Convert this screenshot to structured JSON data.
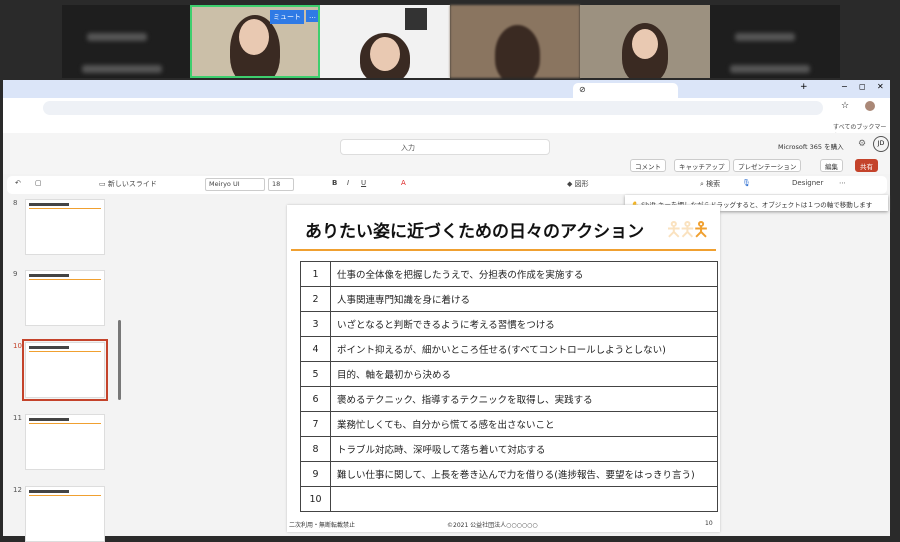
{
  "meeting": {
    "tiles": [
      {
        "state": "video-off"
      },
      {
        "state": "active-speaker",
        "overlay_buttons": [
          "ミュート",
          "…"
        ]
      },
      {
        "state": "video"
      },
      {
        "state": "video"
      },
      {
        "state": "video"
      },
      {
        "state": "video-off"
      }
    ]
  },
  "browser": {
    "window_controls": [
      "−",
      "◻",
      "✕"
    ],
    "new_tab": "+",
    "bookmarks_all": "すべてのブックマーク"
  },
  "app": {
    "search_placeholder": "入力",
    "buy_365": "Microsoft 365 を購入",
    "avatar": "JD",
    "ribbon_buttons": {
      "comment": "コメント",
      "catchup": "キャッチアップ",
      "present": "プレゼンテーション",
      "edit": "編集",
      "share": "共有"
    },
    "toolbar": {
      "new_slide": "新しいスライド",
      "font": "Meiryo UI",
      "size": "18",
      "shapes": "図形",
      "search": "検索",
      "designer": "Designer",
      "more": "⋯"
    },
    "tooltip": "Shift キーを押しながらドラッグすると、オブジェクトは１つの軸で移動します"
  },
  "thumbnails": [
    {
      "num": "8"
    },
    {
      "num": "9"
    },
    {
      "num": "10",
      "selected": true
    },
    {
      "num": "11"
    },
    {
      "num": "12"
    }
  ],
  "slide": {
    "title": "ありたい姿に近づくための日々のアクション",
    "rows": [
      {
        "n": "1",
        "text": "仕事の全体像を把握したうえで、分担表の作成を実施する"
      },
      {
        "n": "2",
        "text": "人事関連専門知識を身に着ける"
      },
      {
        "n": "3",
        "text": "いざとなると判断できるように考える習慣をつける"
      },
      {
        "n": "4",
        "text": "ポイント抑えるが、細かいところ任せる(すべてコントロールしようとしない)"
      },
      {
        "n": "5",
        "text": "目的、軸を最初から決める"
      },
      {
        "n": "6",
        "text": "褒めるテクニック、指導するテクニックを取得し、実践する"
      },
      {
        "n": "7",
        "text": "業務忙しくても、自分から慌てる感を出さないこと"
      },
      {
        "n": "8",
        "text": "トラブル対応時、深呼吸して落ち着いて対応する"
      },
      {
        "n": "9",
        "text": "難しい仕事に関して、上長を巻き込んで力を借りる(進捗報告、要望をはっきり言う)"
      },
      {
        "n": "10",
        "text": ""
      }
    ],
    "footer_left": "二次利用・無断転載禁止",
    "footer_center": "©2021 公益社団法人○○○○○○",
    "page": "10"
  },
  "colors": {
    "accent": "#f0a030",
    "share": "#c4432b",
    "active_tile": "#3ecf6e"
  }
}
